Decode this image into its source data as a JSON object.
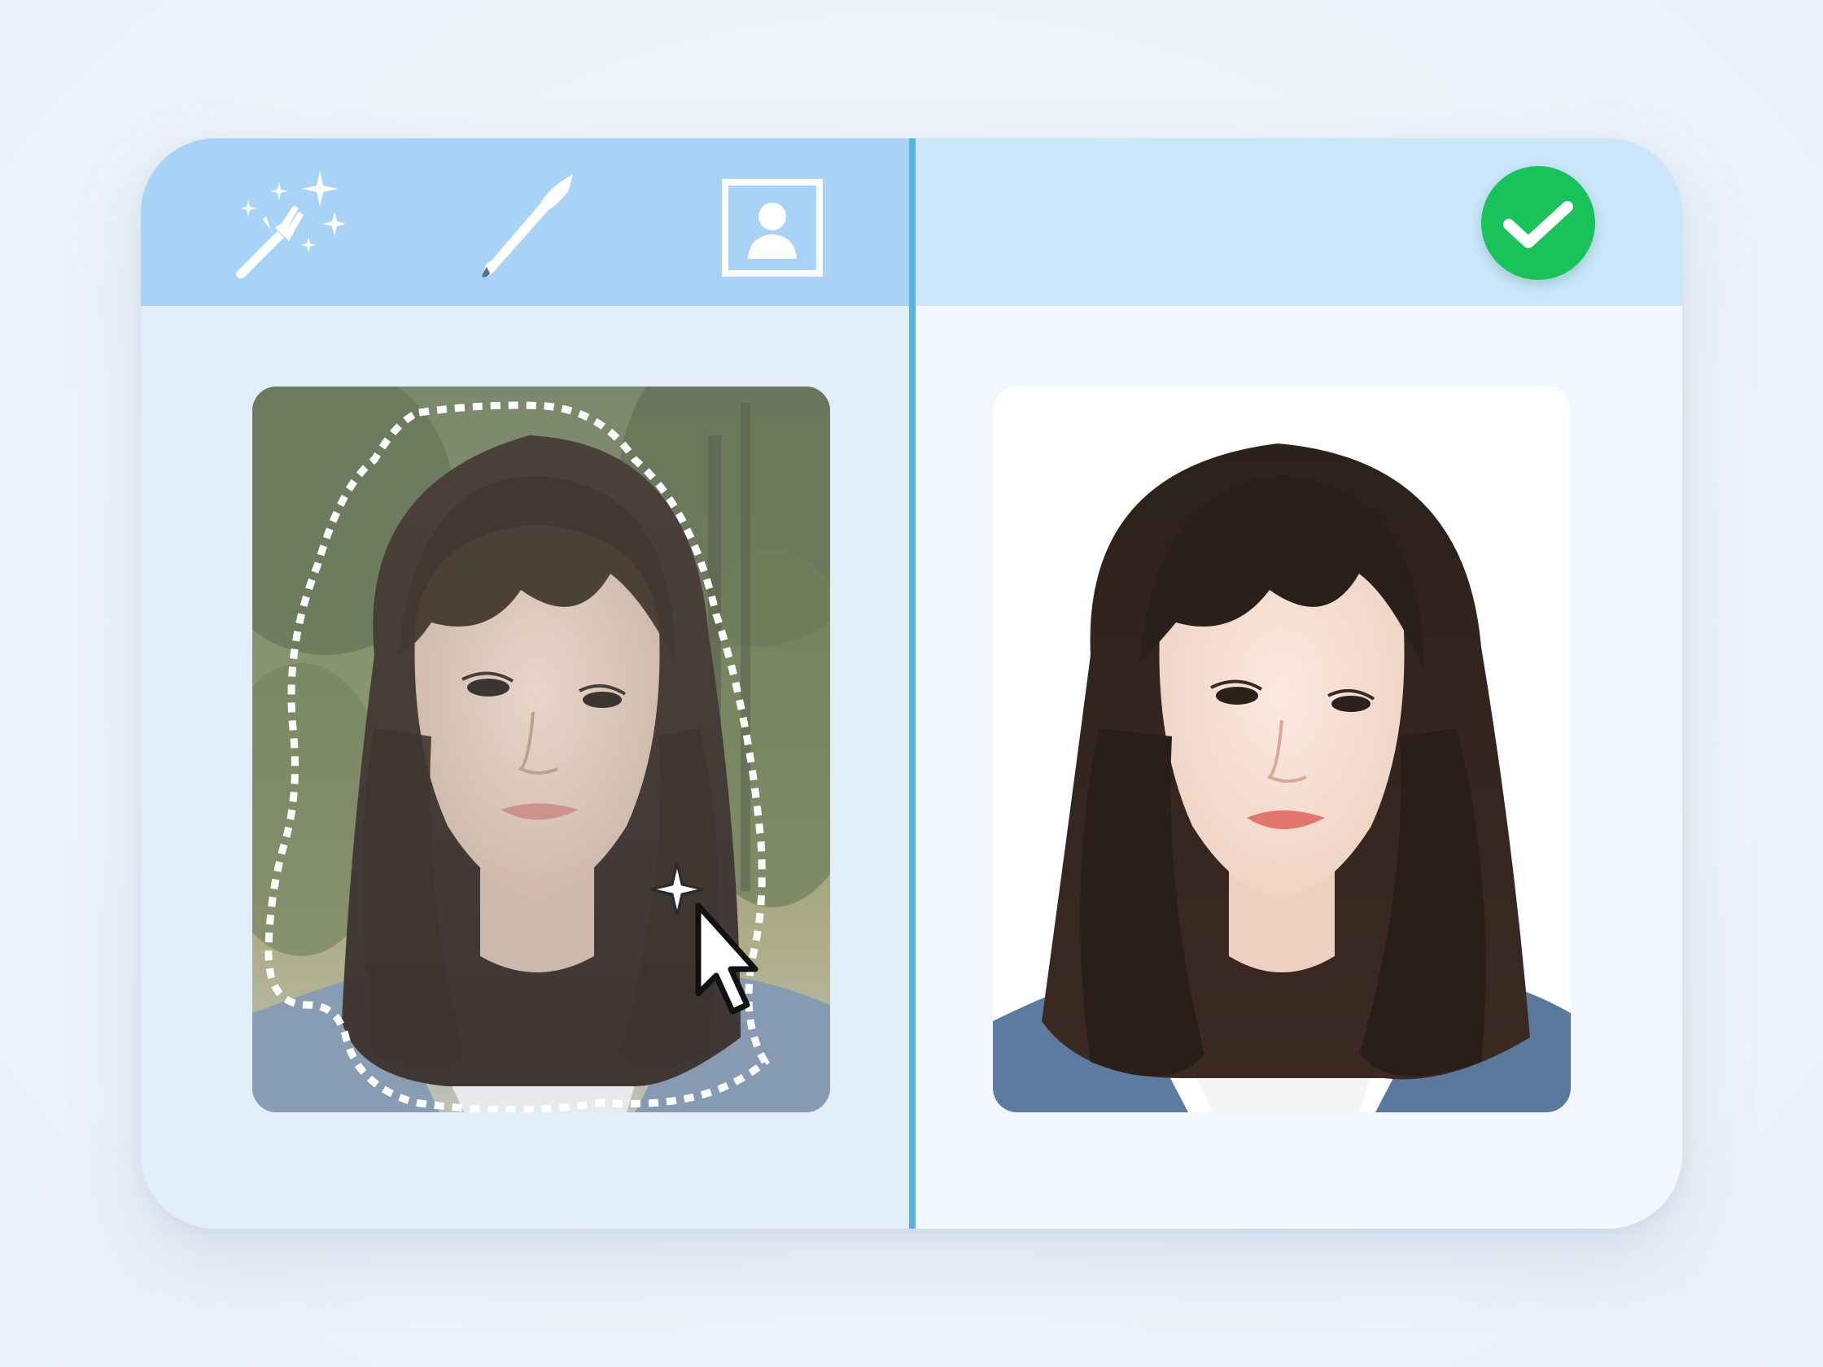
{
  "app": {
    "name": "background-removal-editor"
  },
  "toolbar": {
    "tools": [
      {
        "id": "magic-wand",
        "icon": "magic-wand-icon"
      },
      {
        "id": "brush",
        "icon": "brush-icon"
      },
      {
        "id": "portrait",
        "icon": "portrait-frame-icon"
      }
    ],
    "done_icon": "checkmark-icon"
  },
  "colors": {
    "toolbar_left": "#a8d3f6",
    "toolbar_right": "#cbe5fb",
    "divider": "#5bb3dc",
    "done_green": "#19c25a",
    "selection_outline": "#ffffff"
  },
  "panels": {
    "left": {
      "content": "original-photo-with-selection",
      "cursor_icon": "pointer-cursor-icon",
      "sparkle_icon": "sparkle-icon"
    },
    "right": {
      "content": "result-photo-white-background"
    }
  }
}
